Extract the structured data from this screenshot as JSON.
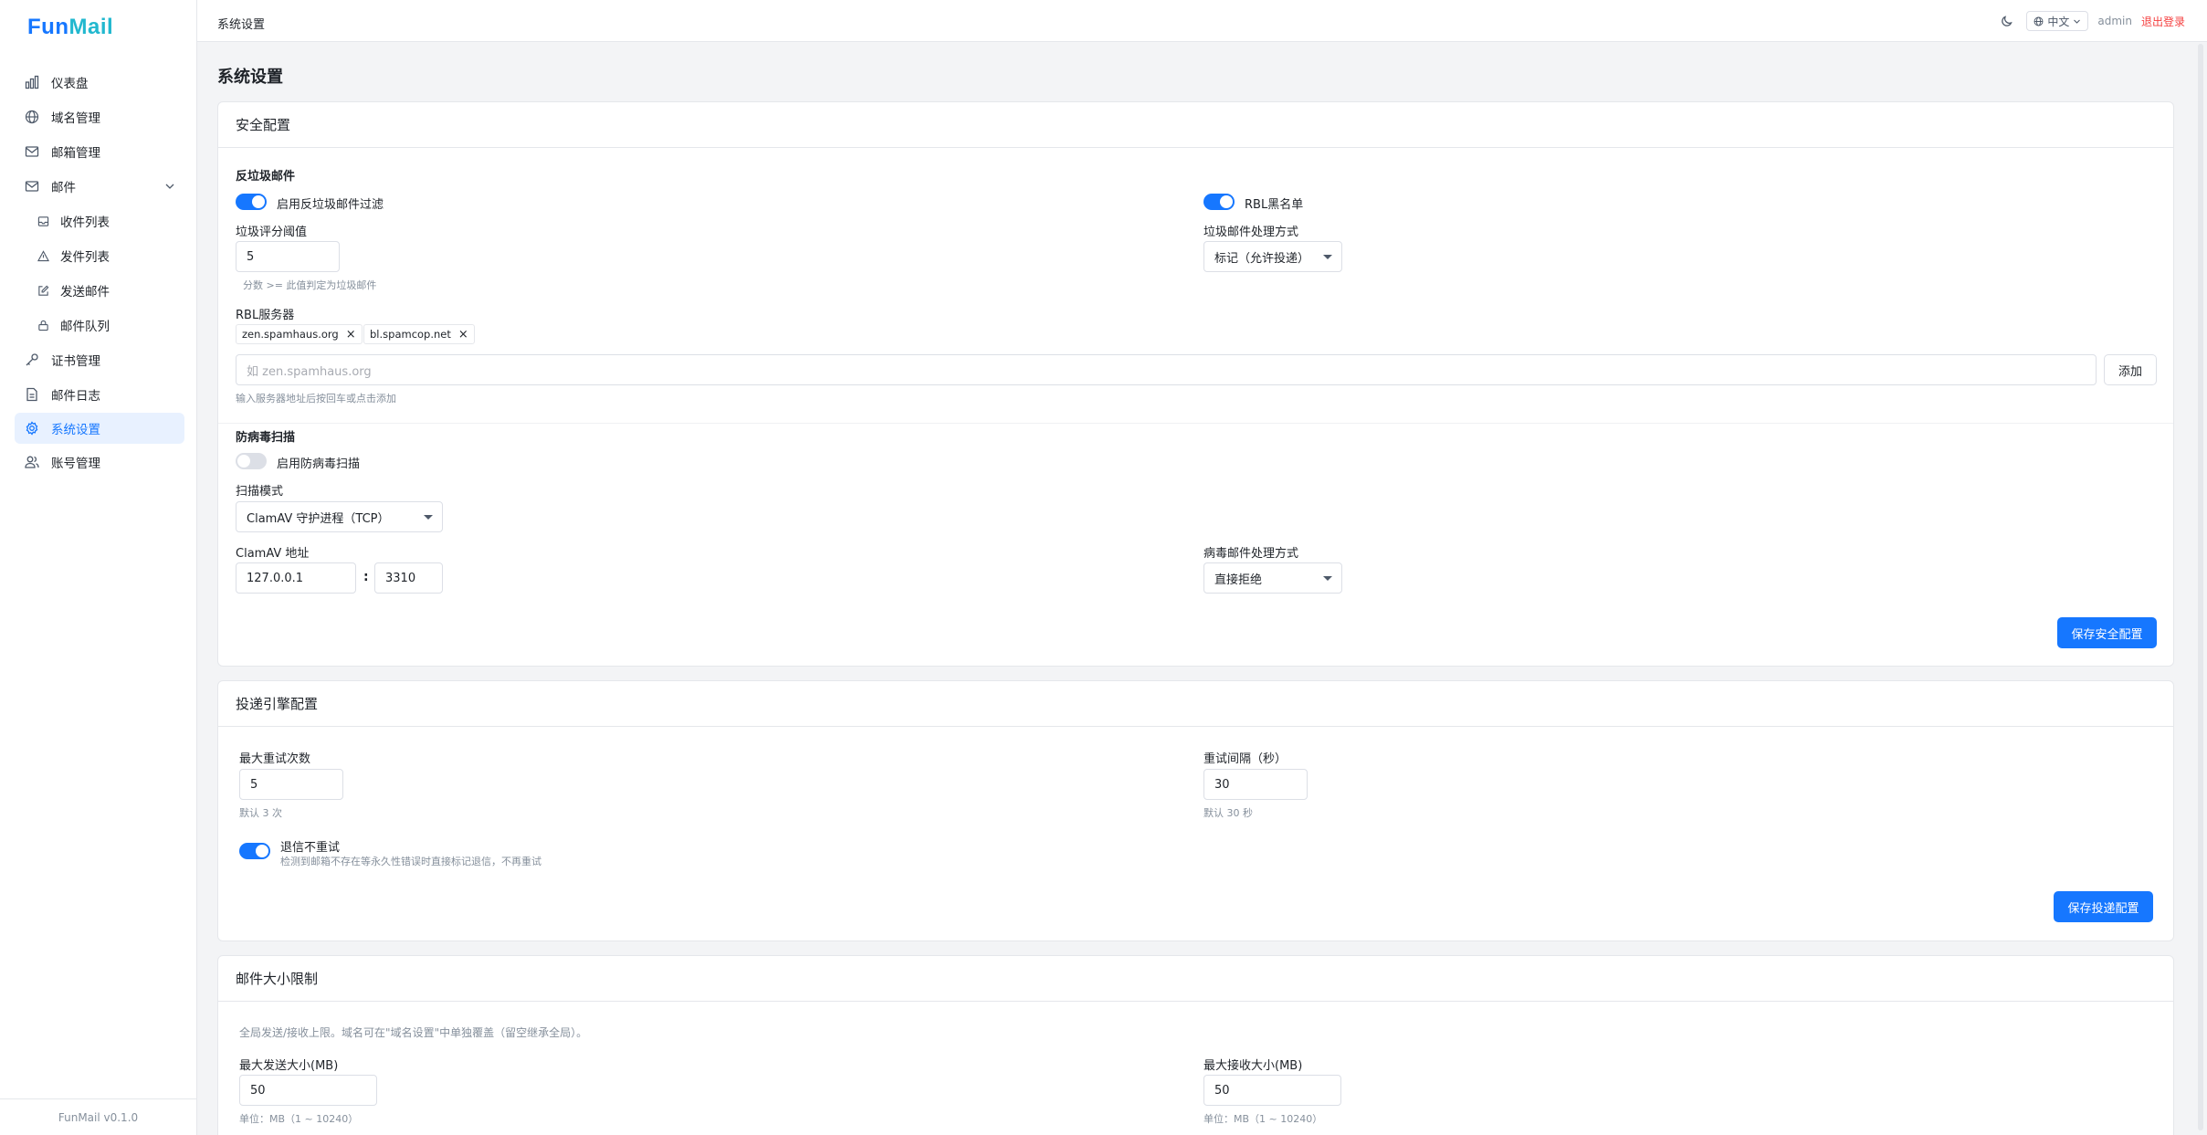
{
  "app": {
    "logo": "FunMail",
    "version": "FunMail v0.1.0"
  },
  "sidebar": {
    "items": [
      {
        "label": "仪表盘",
        "icon": "bar-chart-icon"
      },
      {
        "label": "域名管理",
        "icon": "globe-icon"
      },
      {
        "label": "邮箱管理",
        "icon": "mail-icon"
      },
      {
        "label": "邮件",
        "icon": "mail-icon"
      },
      {
        "label": "收件列表",
        "icon": "inbox-icon"
      },
      {
        "label": "发件列表",
        "icon": "send-icon"
      },
      {
        "label": "发送邮件",
        "icon": "edit-icon"
      },
      {
        "label": "邮件队列",
        "icon": "lock-icon"
      },
      {
        "label": "证书管理",
        "icon": "key-icon"
      },
      {
        "label": "邮件日志",
        "icon": "file-icon"
      },
      {
        "label": "系统设置",
        "icon": "gear-icon"
      },
      {
        "label": "账号管理",
        "icon": "users-icon"
      }
    ]
  },
  "header": {
    "breadcrumb": "系统设置",
    "language": "中文",
    "user": "admin",
    "logout": "退出登录"
  },
  "page": {
    "title": "系统设置"
  },
  "security": {
    "title": "安全配置",
    "antispam": {
      "section": "反垃圾邮件",
      "enable_label": "启用反垃圾邮件过滤",
      "enable_on": true,
      "rbl_label": "RBL黑名单",
      "rbl_on": true,
      "threshold_label": "垃圾评分阈值",
      "threshold_value": "5",
      "threshold_hint": "分数 >= 此值判定为垃圾邮件",
      "action_label": "垃圾邮件处理方式",
      "action_value": "标记（允许投递）",
      "rbl_servers_label": "RBL服务器",
      "rbl_servers": [
        "zen.spamhaus.org",
        "bl.spamcop.net"
      ],
      "rbl_input_placeholder": "如 zen.spamhaus.org",
      "add_button": "添加",
      "rbl_hint": "输入服务器地址后按回车或点击添加"
    },
    "antivirus": {
      "section": "防病毒扫描",
      "enable_label": "启用防病毒扫描",
      "enable_on": false,
      "mode_label": "扫描模式",
      "mode_value": "ClamAV 守护进程（TCP）",
      "address_label": "ClamAV 地址",
      "host_value": "127.0.0.1",
      "colon": ":",
      "port_value": "3310",
      "action_label": "病毒邮件处理方式",
      "action_value": "直接拒绝"
    },
    "save_button": "保存安全配置"
  },
  "delivery": {
    "title": "投递引擎配置",
    "max_retry_label": "最大重试次数",
    "max_retry_value": "5",
    "max_retry_hint": "默认 3 次",
    "retry_interval_label": "重试间隔（秒）",
    "retry_interval_value": "30",
    "retry_interval_hint": "默认 30 秒",
    "bounce_label": "退信不重试",
    "bounce_on": true,
    "bounce_hint": "检测到邮箱不存在等永久性错误时直接标记退信，不再重试",
    "save_button": "保存投递配置"
  },
  "size_limit": {
    "title": "邮件大小限制",
    "desc": "全局发送/接收上限。域名可在\"域名设置\"中单独覆盖（留空继承全局）。",
    "max_send_label": "最大发送大小(MB)",
    "max_send_value": "50",
    "max_send_hint": "单位：MB（1 ~ 10240）",
    "max_recv_label": "最大接收大小(MB)",
    "max_recv_value": "50",
    "max_recv_hint": "单位：MB（1 ~ 10240）"
  },
  "colors": {
    "accent": "#1677ff",
    "danger": "#f53f3f"
  }
}
